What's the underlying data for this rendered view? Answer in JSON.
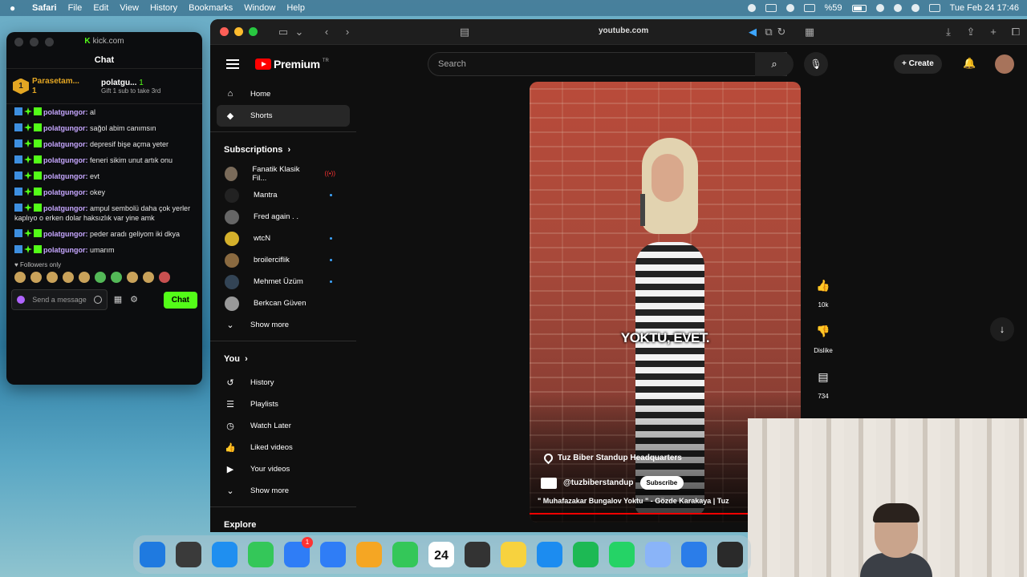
{
  "menubar": {
    "apple": "",
    "items": [
      "Safari",
      "File",
      "Edit",
      "View",
      "History",
      "Bookmarks",
      "Window",
      "Help"
    ],
    "battery": "%59",
    "datetime": "Tue Feb 24  17:46"
  },
  "kick": {
    "domain": "kick.com",
    "header": "Chat",
    "gift_left": {
      "rank": "1",
      "name": "Parasetam...",
      "count": "1"
    },
    "gift_right": {
      "name": "polatgu...",
      "count": "1",
      "sub": "Gift 1 sub to take 3rd"
    },
    "messages": [
      {
        "user": "polatgungor:",
        "text": " al"
      },
      {
        "user": "polatgungor:",
        "text": " sağol abim canımsın"
      },
      {
        "user": "polatgungor:",
        "text": " depresif bişe açma yeter"
      },
      {
        "user": "polatgungor:",
        "text": " feneri sikim unut artık onu"
      },
      {
        "user": "polatgungor:",
        "text": " evt"
      },
      {
        "user": "polatgungor:",
        "text": " okey"
      },
      {
        "user": "polatgungor:",
        "text": " ampul sembolü daha çok yerler kaplıyo o erken dolar haksızlık var yine amk"
      },
      {
        "user": "polatgungor:",
        "text": " peder aradı geliyom iki dkya"
      },
      {
        "user": "polatgungor:",
        "text": " umarım"
      }
    ],
    "followers_only": "Followers only",
    "input_placeholder": "Send a message",
    "chat_button": "Chat"
  },
  "safari": {
    "url": "youtube.com"
  },
  "youtube": {
    "logo": "Premium",
    "logo_suffix": "TR",
    "search_placeholder": "Search",
    "create": "Create",
    "nav": [
      {
        "label": "Home",
        "icon": "⌂"
      },
      {
        "label": "Shorts",
        "icon": "◆"
      }
    ],
    "subscriptions_title": "Subscriptions",
    "subscriptions": [
      {
        "name": "Fanatik Klasik Fil...",
        "status": "live"
      },
      {
        "name": "Mantra",
        "status": "dot"
      },
      {
        "name": "Fred again . .",
        "status": ""
      },
      {
        "name": "wtcN",
        "status": "dot"
      },
      {
        "name": "broilerciflik",
        "status": "dot"
      },
      {
        "name": "Mehmet Üzüm",
        "status": "dot"
      },
      {
        "name": "Berkcan Güven",
        "status": ""
      }
    ],
    "show_more": "Show more",
    "you_title": "You",
    "you_items": [
      {
        "label": "History",
        "icon": "↺"
      },
      {
        "label": "Playlists",
        "icon": "☰"
      },
      {
        "label": "Watch Later",
        "icon": "◷"
      },
      {
        "label": "Liked videos",
        "icon": "👍"
      },
      {
        "label": "Your videos",
        "icon": "▶"
      }
    ],
    "show_more_2": "Show more",
    "explore_title": "Explore",
    "video": {
      "caption": "YOKTU, EVET.",
      "location": "Tuz Biber Standup Headquarters",
      "channel": "@tuzbiberstandup",
      "subscribe": "Subscribe",
      "title": "\" Muhafazakar Bungalov Yoktu \" - Gözde Karakaya | Tuz"
    },
    "actions": {
      "likes": "10k",
      "dislike": "Dislike",
      "comments": "734"
    }
  },
  "dock": {
    "calendar_day": "24",
    "mail_badge": "1",
    "colors": [
      "#1f7ae0",
      "#3a3a3a",
      "#1f8ff0",
      "#34c759",
      "#2f7df6",
      "#2f7df6",
      "#f5a623",
      "#34c759",
      "#ffffff",
      "#333333",
      "#f7d23e",
      "#1c8cf0",
      "#1db954",
      "#25d366",
      "#8ab4f8",
      "#2b7de9",
      "#2a2a2a"
    ]
  }
}
